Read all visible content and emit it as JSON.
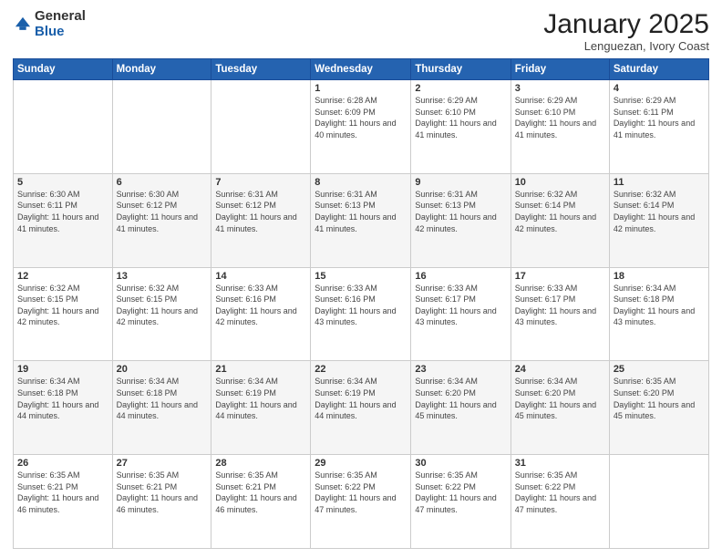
{
  "header": {
    "logo_general": "General",
    "logo_blue": "Blue",
    "title": "January 2025",
    "subtitle": "Lenguezan, Ivory Coast"
  },
  "days_of_week": [
    "Sunday",
    "Monday",
    "Tuesday",
    "Wednesday",
    "Thursday",
    "Friday",
    "Saturday"
  ],
  "weeks": [
    [
      {
        "day": "",
        "info": ""
      },
      {
        "day": "",
        "info": ""
      },
      {
        "day": "",
        "info": ""
      },
      {
        "day": "1",
        "info": "Sunrise: 6:28 AM\nSunset: 6:09 PM\nDaylight: 11 hours and 40 minutes."
      },
      {
        "day": "2",
        "info": "Sunrise: 6:29 AM\nSunset: 6:10 PM\nDaylight: 11 hours and 41 minutes."
      },
      {
        "day": "3",
        "info": "Sunrise: 6:29 AM\nSunset: 6:10 PM\nDaylight: 11 hours and 41 minutes."
      },
      {
        "day": "4",
        "info": "Sunrise: 6:29 AM\nSunset: 6:11 PM\nDaylight: 11 hours and 41 minutes."
      }
    ],
    [
      {
        "day": "5",
        "info": "Sunrise: 6:30 AM\nSunset: 6:11 PM\nDaylight: 11 hours and 41 minutes."
      },
      {
        "day": "6",
        "info": "Sunrise: 6:30 AM\nSunset: 6:12 PM\nDaylight: 11 hours and 41 minutes."
      },
      {
        "day": "7",
        "info": "Sunrise: 6:31 AM\nSunset: 6:12 PM\nDaylight: 11 hours and 41 minutes."
      },
      {
        "day": "8",
        "info": "Sunrise: 6:31 AM\nSunset: 6:13 PM\nDaylight: 11 hours and 41 minutes."
      },
      {
        "day": "9",
        "info": "Sunrise: 6:31 AM\nSunset: 6:13 PM\nDaylight: 11 hours and 42 minutes."
      },
      {
        "day": "10",
        "info": "Sunrise: 6:32 AM\nSunset: 6:14 PM\nDaylight: 11 hours and 42 minutes."
      },
      {
        "day": "11",
        "info": "Sunrise: 6:32 AM\nSunset: 6:14 PM\nDaylight: 11 hours and 42 minutes."
      }
    ],
    [
      {
        "day": "12",
        "info": "Sunrise: 6:32 AM\nSunset: 6:15 PM\nDaylight: 11 hours and 42 minutes."
      },
      {
        "day": "13",
        "info": "Sunrise: 6:32 AM\nSunset: 6:15 PM\nDaylight: 11 hours and 42 minutes."
      },
      {
        "day": "14",
        "info": "Sunrise: 6:33 AM\nSunset: 6:16 PM\nDaylight: 11 hours and 42 minutes."
      },
      {
        "day": "15",
        "info": "Sunrise: 6:33 AM\nSunset: 6:16 PM\nDaylight: 11 hours and 43 minutes."
      },
      {
        "day": "16",
        "info": "Sunrise: 6:33 AM\nSunset: 6:17 PM\nDaylight: 11 hours and 43 minutes."
      },
      {
        "day": "17",
        "info": "Sunrise: 6:33 AM\nSunset: 6:17 PM\nDaylight: 11 hours and 43 minutes."
      },
      {
        "day": "18",
        "info": "Sunrise: 6:34 AM\nSunset: 6:18 PM\nDaylight: 11 hours and 43 minutes."
      }
    ],
    [
      {
        "day": "19",
        "info": "Sunrise: 6:34 AM\nSunset: 6:18 PM\nDaylight: 11 hours and 44 minutes."
      },
      {
        "day": "20",
        "info": "Sunrise: 6:34 AM\nSunset: 6:18 PM\nDaylight: 11 hours and 44 minutes."
      },
      {
        "day": "21",
        "info": "Sunrise: 6:34 AM\nSunset: 6:19 PM\nDaylight: 11 hours and 44 minutes."
      },
      {
        "day": "22",
        "info": "Sunrise: 6:34 AM\nSunset: 6:19 PM\nDaylight: 11 hours and 44 minutes."
      },
      {
        "day": "23",
        "info": "Sunrise: 6:34 AM\nSunset: 6:20 PM\nDaylight: 11 hours and 45 minutes."
      },
      {
        "day": "24",
        "info": "Sunrise: 6:34 AM\nSunset: 6:20 PM\nDaylight: 11 hours and 45 minutes."
      },
      {
        "day": "25",
        "info": "Sunrise: 6:35 AM\nSunset: 6:20 PM\nDaylight: 11 hours and 45 minutes."
      }
    ],
    [
      {
        "day": "26",
        "info": "Sunrise: 6:35 AM\nSunset: 6:21 PM\nDaylight: 11 hours and 46 minutes."
      },
      {
        "day": "27",
        "info": "Sunrise: 6:35 AM\nSunset: 6:21 PM\nDaylight: 11 hours and 46 minutes."
      },
      {
        "day": "28",
        "info": "Sunrise: 6:35 AM\nSunset: 6:21 PM\nDaylight: 11 hours and 46 minutes."
      },
      {
        "day": "29",
        "info": "Sunrise: 6:35 AM\nSunset: 6:22 PM\nDaylight: 11 hours and 47 minutes."
      },
      {
        "day": "30",
        "info": "Sunrise: 6:35 AM\nSunset: 6:22 PM\nDaylight: 11 hours and 47 minutes."
      },
      {
        "day": "31",
        "info": "Sunrise: 6:35 AM\nSunset: 6:22 PM\nDaylight: 11 hours and 47 minutes."
      },
      {
        "day": "",
        "info": ""
      }
    ]
  ]
}
